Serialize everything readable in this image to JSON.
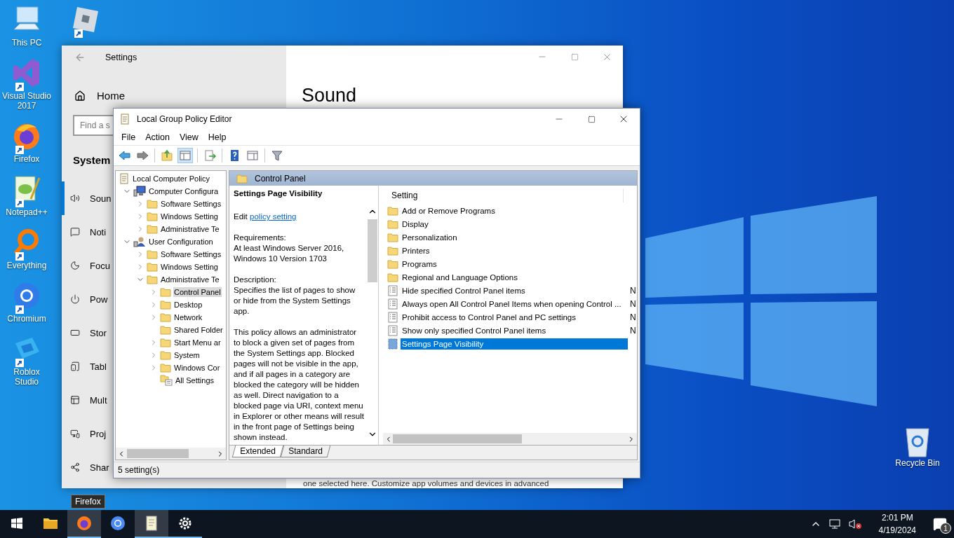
{
  "desktop_icons": [
    {
      "kind": "computer",
      "label": "This PC",
      "shortcut": false
    },
    {
      "kind": "visual-studio",
      "label": "Visual Studio 2017",
      "shortcut": true
    },
    {
      "kind": "firefox",
      "label": "Firefox",
      "shortcut": true
    },
    {
      "kind": "notepad",
      "label": "Notepad++",
      "shortcut": true
    },
    {
      "kind": "everything",
      "label": "Everything",
      "shortcut": true
    },
    {
      "kind": "chromium",
      "label": "Chromium",
      "shortcut": true
    },
    {
      "kind": "roblox-studio",
      "label": "Roblox Studio",
      "shortcut": true
    }
  ],
  "second_column_icon": {
    "kind": "roblox",
    "shortcut": true
  },
  "recycle_bin": {
    "label": "Recycle Bin"
  },
  "settings_window": {
    "title": "Settings",
    "home": "Home",
    "search": {
      "placeholder": "Find a s"
    },
    "section": "System",
    "nav": [
      {
        "kind": "sound",
        "label": "Soun",
        "selected": true
      },
      {
        "kind": "notifications",
        "label": "Noti",
        "selected": false
      },
      {
        "kind": "focus",
        "label": "Focu",
        "selected": false
      },
      {
        "kind": "power",
        "label": "Pow",
        "selected": false
      },
      {
        "kind": "storage",
        "label": "Stor",
        "selected": false
      },
      {
        "kind": "tablet",
        "label": "Tabl",
        "selected": false
      },
      {
        "kind": "multitasking",
        "label": "Mult",
        "selected": false
      },
      {
        "kind": "projecting",
        "label": "Proj",
        "selected": false
      },
      {
        "kind": "shared",
        "label": "Shar",
        "selected": false
      }
    ],
    "page_title": "Sound",
    "body_text": "one selected here. Customize app volumes and devices in advanced"
  },
  "policy_editor": {
    "title": "Local Group Policy Editor",
    "menu": [
      "File",
      "Action",
      "View",
      "Help"
    ],
    "toolbar": [
      {
        "kind": "back"
      },
      {
        "kind": "forward"
      },
      {
        "kind": "separator"
      },
      {
        "kind": "up-folder"
      },
      {
        "kind": "tree-toggle",
        "selected": true
      },
      {
        "kind": "separator"
      },
      {
        "kind": "export"
      },
      {
        "kind": "separator"
      },
      {
        "kind": "help"
      },
      {
        "kind": "properties"
      },
      {
        "kind": "separator"
      },
      {
        "kind": "filter"
      }
    ],
    "tree": [
      {
        "kind": "policy",
        "label": "Local Computer Policy",
        "selected": false,
        "children": [
          {
            "kind": "computer",
            "label": "Computer Configura",
            "expandable": true,
            "expanded": true,
            "selected": false,
            "children": [
              {
                "kind": "folder",
                "label": "Software Settings",
                "expandable": true,
                "expanded": false,
                "selected": false
              },
              {
                "kind": "folder",
                "label": "Windows Setting",
                "expandable": true,
                "expanded": false,
                "selected": false
              },
              {
                "kind": "folder",
                "label": "Administrative Te",
                "expandable": true,
                "expanded": false,
                "selected": false
              }
            ]
          },
          {
            "kind": "user",
            "label": "User Configuration",
            "expandable": true,
            "expanded": true,
            "selected": false,
            "children": [
              {
                "kind": "folder",
                "label": "Software Settings",
                "expandable": true,
                "expanded": false,
                "selected": false
              },
              {
                "kind": "folder",
                "label": "Windows Setting",
                "expandable": true,
                "expanded": false,
                "selected": false
              },
              {
                "kind": "folder",
                "label": "Administrative Te",
                "expandable": true,
                "expanded": true,
                "selected": false,
                "children": [
                  {
                    "kind": "folder",
                    "label": "Control Panel",
                    "expandable": true,
                    "expanded": false,
                    "selected": true
                  },
                  {
                    "kind": "folder",
                    "label": "Desktop",
                    "expandable": true,
                    "expanded": false,
                    "selected": false
                  },
                  {
                    "kind": "folder",
                    "label": "Network",
                    "expandable": true,
                    "expanded": false,
                    "selected": false
                  },
                  {
                    "kind": "folder",
                    "label": "Shared Folder",
                    "selected": false
                  },
                  {
                    "kind": "folder",
                    "label": "Start Menu ar",
                    "expandable": true,
                    "expanded": false,
                    "selected": false
                  },
                  {
                    "kind": "folder",
                    "label": "System",
                    "expandable": true,
                    "expanded": false,
                    "selected": false
                  },
                  {
                    "kind": "folder",
                    "label": "Windows Cor",
                    "expandable": true,
                    "expanded": false,
                    "selected": false
                  },
                  {
                    "kind": "settings-list",
                    "label": "All Settings",
                    "selected": false
                  }
                ]
              }
            ]
          }
        ]
      }
    ],
    "header": "Control Panel",
    "description": {
      "title": "Settings Page Visibility",
      "edit_prefix": "Edit",
      "edit_link": "policy setting",
      "requirements_label": "Requirements:",
      "requirements": "At least Windows Server 2016, Windows 10 Version 1703",
      "description_label": "Description:",
      "paragraphs": [
        "Specifies the list of pages to show or hide from the System Settings app.",
        "This policy allows an administrator to block a given set of pages from the System Settings app. Blocked pages will not be visible in the app, and if all pages in a category are blocked the category will be hidden as well. Direct navigation to a blocked page via URI, context menu in Explorer or other means will result in the front page of Settings being shown instead."
      ]
    },
    "list": {
      "column": "Setting",
      "rows": [
        {
          "kind": "folder",
          "label": "Add or Remove Programs",
          "selected": false
        },
        {
          "kind": "folder",
          "label": "Display",
          "selected": false
        },
        {
          "kind": "folder",
          "label": "Personalization",
          "selected": false
        },
        {
          "kind": "folder",
          "label": "Printers",
          "selected": false
        },
        {
          "kind": "folder",
          "label": "Programs",
          "selected": false
        },
        {
          "kind": "folder",
          "label": "Regional and Language Options",
          "selected": false
        },
        {
          "kind": "policy",
          "label": "Hide specified Control Panel items",
          "state": "N",
          "selected": false
        },
        {
          "kind": "policy",
          "label": "Always open All Control Panel Items when opening Control ...",
          "state": "N",
          "selected": false
        },
        {
          "kind": "policy",
          "label": "Prohibit access to Control Panel and PC settings",
          "state": "N",
          "selected": false
        },
        {
          "kind": "policy",
          "label": "Show only specified Control Panel items",
          "state": "N",
          "selected": false
        },
        {
          "kind": "policy-dotted",
          "label": "Settings Page Visibility",
          "selected": true
        }
      ]
    },
    "tabs": [
      {
        "label": "Extended",
        "selected": true
      },
      {
        "label": "Standard",
        "selected": false
      }
    ],
    "status": "5 setting(s)"
  },
  "taskbar": {
    "apps": [
      {
        "kind": "file-explorer",
        "running": false,
        "highlighted": false
      },
      {
        "kind": "firefox",
        "running": true,
        "highlighted": true
      },
      {
        "kind": "chromium",
        "running": false,
        "highlighted": false
      },
      {
        "kind": "notepad",
        "running": true,
        "highlighted": true
      },
      {
        "kind": "settings",
        "running": true,
        "highlighted": false
      }
    ],
    "tooltip": "Firefox",
    "time": "2:01 PM",
    "date": "4/19/2024",
    "notification_count": "1"
  }
}
